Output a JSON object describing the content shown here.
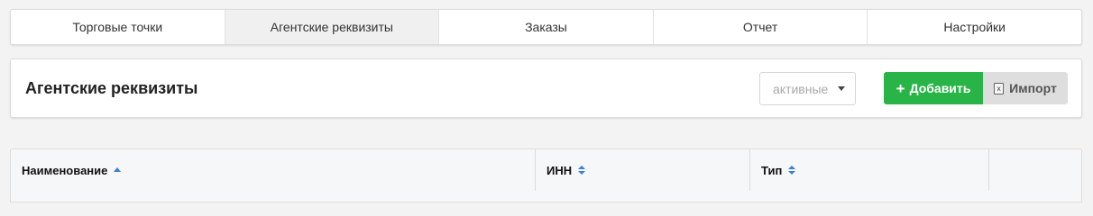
{
  "tabs": [
    {
      "label": "Торговые точки",
      "active": false
    },
    {
      "label": "Агентские реквизиты",
      "active": true
    },
    {
      "label": "Заказы",
      "active": false
    },
    {
      "label": "Отчет",
      "active": false
    },
    {
      "label": "Настройки",
      "active": false
    }
  ],
  "panel": {
    "title": "Агентские реквизиты",
    "filter_value": "активные",
    "add_label": "Добавить",
    "import_label": "Импорт",
    "add_icon": "plus-icon",
    "import_icon": "xls-file-icon",
    "import_icon_glyph": "x"
  },
  "table": {
    "columns": [
      {
        "label": "Наименование",
        "sort": "asc"
      },
      {
        "label": "ИНН",
        "sort": "both"
      },
      {
        "label": "Тип",
        "sort": "both"
      },
      {
        "label": "",
        "sort": "none"
      }
    ]
  },
  "colors": {
    "accent_green": "#28b446",
    "sort_blue": "#3b7dd8",
    "active_tab_bg": "#f0f0f0"
  }
}
